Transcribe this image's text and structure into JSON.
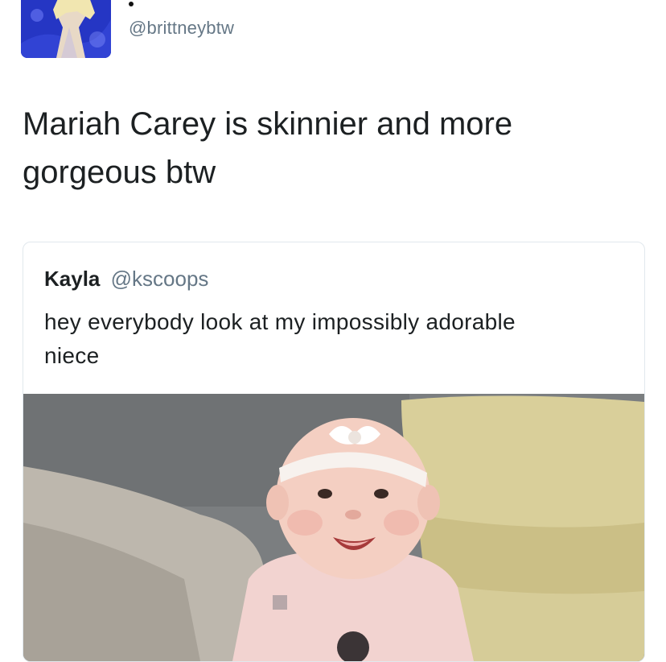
{
  "tweet": {
    "handle": "@brittneybtw",
    "text": "Mariah Carey is skinnier and more gorgeous btw"
  },
  "quoted": {
    "name": "Kayla",
    "handle": "@kscoops",
    "text": "hey everybody look at my impossibly adorable niece"
  },
  "colors": {
    "text": "#1c2022",
    "secondary": "#657786",
    "border": "#e1e8ed"
  }
}
